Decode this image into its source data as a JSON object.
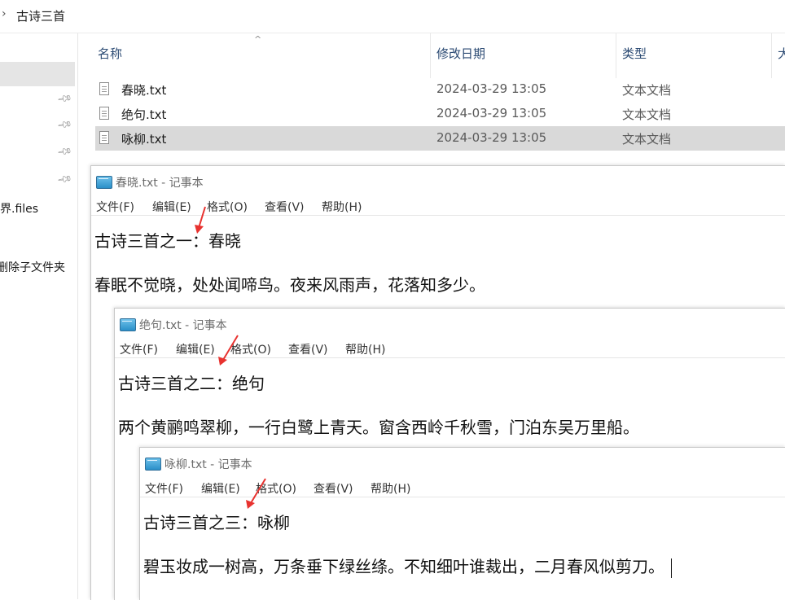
{
  "breadcrumb": {
    "chevron": "›",
    "current": "古诗三首"
  },
  "nav": {
    "item_files": "界.files",
    "item_delete": "删除子文件夹"
  },
  "columns": {
    "name": "名称",
    "date": "修改日期",
    "type": "类型",
    "size": "大"
  },
  "files": [
    {
      "name": "春晓.txt",
      "date": "2024-03-29 13:05",
      "type": "文本文档"
    },
    {
      "name": "绝句.txt",
      "date": "2024-03-29 13:05",
      "type": "文本文档"
    },
    {
      "name": "咏柳.txt",
      "date": "2024-03-29 13:05",
      "type": "文本文档"
    }
  ],
  "menu": {
    "file": "文件(F)",
    "edit": "编辑(E)",
    "format": "格式(O)",
    "view": "查看(V)",
    "help": "帮助(H)"
  },
  "windows": [
    {
      "title": "春晓.txt - 记事本",
      "line1": "古诗三首之一：春晓",
      "line3": "春眠不觉晓，处处闻啼鸟。夜来风雨声，花落知多少。"
    },
    {
      "title": "绝句.txt - 记事本",
      "line1": "古诗三首之二：绝句",
      "line3": "两个黄鹂鸣翠柳，一行白鹭上青天。窗含西岭千秋雪，门泊东吴万里船。"
    },
    {
      "title": "咏柳.txt - 记事本",
      "line1": "古诗三首之三：咏柳",
      "line3": "碧玉妆成一树高，万条垂下绿丝绦。不知细叶谁裁出，二月春风似剪刀。"
    }
  ],
  "colors": {
    "arrow": "#e8322f",
    "selection": "#d9d9d9",
    "header_text": "#2b4a73"
  }
}
